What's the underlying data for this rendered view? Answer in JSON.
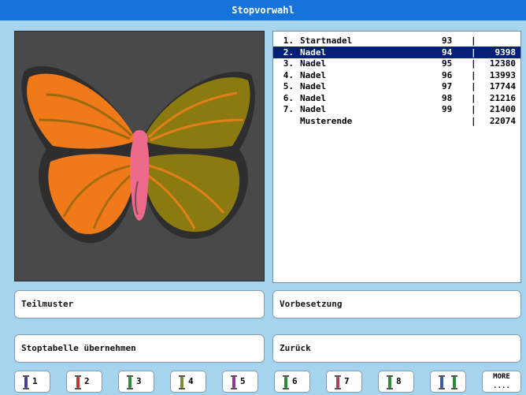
{
  "window": {
    "title": "Stopvorwahl"
  },
  "preview": {
    "description_icon": "butterfly-embroidery-icon"
  },
  "stop_table": {
    "selected_index": 1,
    "rows": [
      {
        "num": "1.",
        "name": "Startnadel",
        "stitch": "93",
        "sep": "|",
        "value": ""
      },
      {
        "num": "2.",
        "name": "Nadel",
        "stitch": "94",
        "sep": "|",
        "value": "9398"
      },
      {
        "num": "3.",
        "name": "Nadel",
        "stitch": "95",
        "sep": "|",
        "value": "12380"
      },
      {
        "num": "4.",
        "name": "Nadel",
        "stitch": "96",
        "sep": "|",
        "value": "13993"
      },
      {
        "num": "5.",
        "name": "Nadel",
        "stitch": "97",
        "sep": "|",
        "value": "17744"
      },
      {
        "num": "6.",
        "name": "Nadel",
        "stitch": "98",
        "sep": "|",
        "value": "21216"
      },
      {
        "num": "7.",
        "name": "Nadel",
        "stitch": "99",
        "sep": "|",
        "value": "21400"
      },
      {
        "num": "",
        "name": "Musterende",
        "stitch": "",
        "sep": "|",
        "value": "22074"
      }
    ]
  },
  "buttons": {
    "teilmuster": "Teilmuster",
    "vorbesetzung": "Vorbesetzung",
    "stoptabelle": "Stoptabelle übernehmen",
    "zurueck": "Zurück"
  },
  "toolbar": {
    "needles": [
      {
        "label": "1",
        "color": "#4a3f8f"
      },
      {
        "label": "2",
        "color": "#c0392b"
      },
      {
        "label": "3",
        "color": "#2e8b3e"
      },
      {
        "label": "4",
        "color": "#7a8c3a"
      },
      {
        "label": "5",
        "color": "#8e3a8e"
      },
      {
        "label": "6",
        "color": "#2e8b3e"
      },
      {
        "label": "7",
        "color": "#b04060"
      },
      {
        "label": "8",
        "color": "#2e8b3e"
      },
      {
        "label": "",
        "color": "#3a5ba0"
      }
    ],
    "more_label": "MORE",
    "more_dots": "...."
  },
  "colors": {
    "titlebar": "#1673d9",
    "background": "#a6d4ee",
    "selection": "#051e7c",
    "wing_orange": "#f07a1a",
    "wing_olive": "#8a7a10",
    "body_pink": "#ee6a8a"
  }
}
